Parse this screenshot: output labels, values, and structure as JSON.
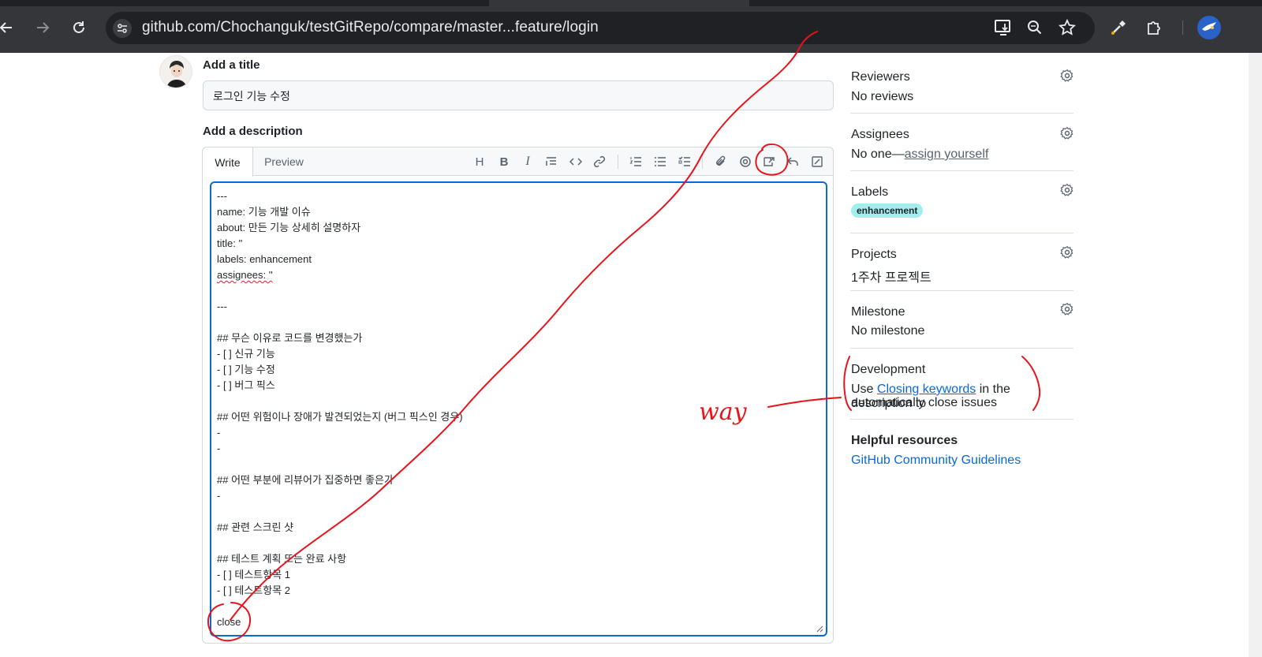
{
  "browser": {
    "url": "github.com/Chochanguk/testGitRepo/compare/master...feature/login",
    "icons": [
      "back-arrow-icon",
      "forward-arrow-icon",
      "reload-icon",
      "site-info-icon",
      "install-app-icon",
      "zoom-icon",
      "bookmark-star-icon",
      "eyedropper-icon",
      "extensions-icon",
      "profile-avatar"
    ]
  },
  "form": {
    "title_label": "Add a title",
    "title_value": "로그인 기능 수정",
    "description_label": "Add a description",
    "tabs": [
      "Write",
      "Preview"
    ],
    "toolbar": [
      "heading-icon",
      "bold-icon",
      "italic-icon",
      "quote-icon",
      "code-icon",
      "link-icon",
      "ordered-list-icon",
      "unordered-list-icon",
      "task-list-icon",
      "attach-icon",
      "mention-icon",
      "cross-reference-icon",
      "undo-icon",
      "fullscreen-icon"
    ],
    "toolbar_glyphs": {
      "heading": "H",
      "bold": "B",
      "italic": "I"
    },
    "body_lines": [
      "---",
      "name: 기능 개발 이슈",
      "about: 만든 기능 상세히 설명하자",
      "title: ''",
      "labels: enhancement",
      "assignees: ''",
      "",
      "---",
      "",
      "## 무슨 이유로 코드를 변경했는가",
      "- [ ] 신규 기능",
      "- [ ] 기능 수정",
      "- [ ] 버그 픽스",
      "",
      "## 어떤 위험이나 장애가 발견되었는지 (버그 픽스인 경우)",
      "-",
      "-",
      "",
      "## 어떤 부분에 리뷰어가 집중하면 좋은가",
      "-",
      "",
      "## 관련 스크린 샷",
      "",
      "## 테스트 계획 또는 완료 사항",
      "- [ ] 테스트항목 1",
      "- [ ] 테스트항목 2",
      "",
      "close"
    ]
  },
  "sidebar": {
    "reviewers": {
      "heading": "Reviewers",
      "value": "No reviews"
    },
    "assignees": {
      "heading": "Assignees",
      "value_prefix": "No one—",
      "value_link": "assign yourself"
    },
    "labels": {
      "heading": "Labels",
      "value": "enhancement",
      "color": "#a2eeef"
    },
    "projects": {
      "heading": "Projects",
      "value": "1주차 프로젝트"
    },
    "milestone": {
      "heading": "Milestone",
      "value": "No milestone"
    },
    "development": {
      "heading": "Development",
      "text_before": "Use ",
      "link": "Closing keywords",
      "text_after": " in the description to",
      "text_line2": "automatically close issues"
    },
    "helpful": {
      "heading": "Helpful resources",
      "link": "GitHub Community Guidelines"
    }
  },
  "annotation": {
    "handwritten_text": "way",
    "color": "#e8141c"
  },
  "colors": {
    "accent": "#0969da",
    "chrome_bg": "#35363a",
    "omnibox_bg": "#202124"
  }
}
